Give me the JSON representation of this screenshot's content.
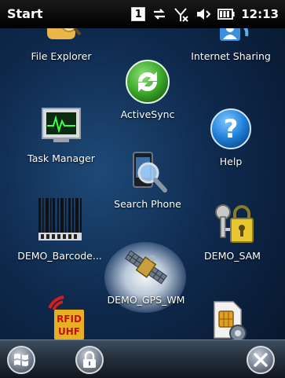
{
  "status_bar": {
    "title": "Start",
    "notification_count": "1",
    "time": "12:13",
    "icons": [
      "notification-badge-icon",
      "connectivity-icon",
      "no-signal-icon",
      "volume-icon",
      "battery-icon"
    ]
  },
  "apps": [
    {
      "label": "File Explorer",
      "icon": "folder-icon"
    },
    {
      "label": "Internet Sharing",
      "icon": "internet-sharing-icon"
    },
    {
      "label": "ActiveSync",
      "icon": "activesync-icon"
    },
    {
      "label": "Task Manager",
      "icon": "task-manager-icon"
    },
    {
      "label": "Help",
      "icon": "help-icon"
    },
    {
      "label": "Search Phone",
      "icon": "search-phone-icon"
    },
    {
      "label": "DEMO_Barcode...",
      "icon": "barcode-icon"
    },
    {
      "label": "DEMO_SAM",
      "icon": "keys-lock-icon"
    },
    {
      "label": "DEMO_GPS_WM",
      "icon": "satellite-icon"
    },
    {
      "label": "",
      "icon": "rfid-uhf-icon",
      "icon_text": [
        "RFID",
        "UHF"
      ]
    },
    {
      "label": "",
      "icon": "sim-settings-icon"
    }
  ],
  "selected_app": "DEMO_GPS_WM",
  "bottom_bar": {
    "buttons": [
      "windows-start-icon",
      "lock-icon",
      "close-icon"
    ]
  },
  "colors": {
    "background": "#0f2a4e",
    "status_bar": "#000000",
    "activesync_green": "#3caa2a",
    "help_blue": "#1e7fd8"
  }
}
